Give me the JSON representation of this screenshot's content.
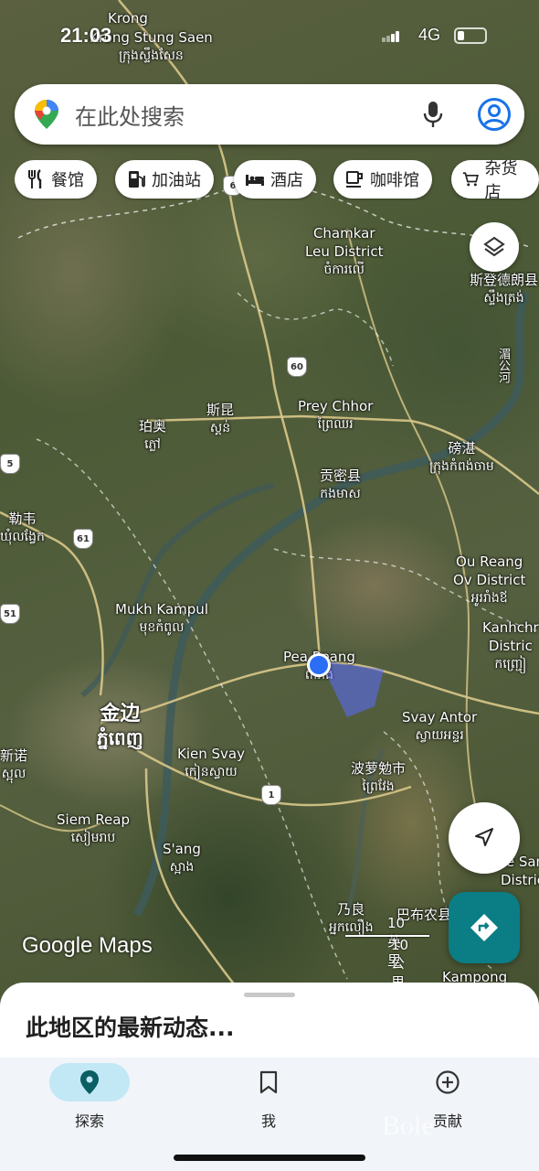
{
  "status_bar": {
    "time": "21:03",
    "network": "4G",
    "battery_level": 0.25
  },
  "search": {
    "placeholder": "在此处搜索"
  },
  "chips": [
    {
      "label": "餐馆",
      "icon": "restaurant-icon"
    },
    {
      "label": "加油站",
      "icon": "gas-station-icon"
    },
    {
      "label": "酒店",
      "icon": "hotel-icon"
    },
    {
      "label": "咖啡馆",
      "icon": "coffee-icon"
    },
    {
      "label": "杂货店",
      "icon": "grocery-cart-icon"
    }
  ],
  "map": {
    "places": [
      {
        "name": "Krong Stung Saen",
        "prefix": "Krong",
        "khmer": "ក្រុងស្ទឹងសែន"
      },
      {
        "name": "Chamkar Leu District",
        "line1": "Chamkar",
        "line2": "Leu District",
        "khmer": "ចំការលើ"
      },
      {
        "name": "斯登德朗县",
        "khmer": "ស្ទឹងត្រង់"
      },
      {
        "name": "Prey Chhor",
        "khmer": "ព្រៃឈរ"
      },
      {
        "name": "斯昆",
        "khmer": "ស្គន់"
      },
      {
        "name": "珀奥",
        "khmer": "ភ្លៅ"
      },
      {
        "name": "贡密县",
        "khmer": "កងមាស"
      },
      {
        "name": "磅湛",
        "khmer": "ក្រុងកំពង់ចាម"
      },
      {
        "name": "勒韦",
        "khmer": "ឃុំលង្វែក"
      },
      {
        "name": "Ou Reang Ov District",
        "line1": "Ou Reang",
        "line2": "Ov District",
        "khmer": "អូររាំងឪ"
      },
      {
        "name": "Mukh Kampul",
        "khmer": "មុខកំពូល"
      },
      {
        "name": "Pea Reang",
        "khmer": "ពារាំង"
      },
      {
        "name": "Kanhchriech District",
        "line1": "Kanhchr",
        "line2": "Distric",
        "khmer": "កញ្ជ្រៀ"
      },
      {
        "name": "Svay Antor",
        "khmer": "ស្វាយអន្ទរ"
      },
      {
        "name": "金边",
        "khmer": "ភ្នំពេញ"
      },
      {
        "name": "Kien Svay",
        "khmer": "កៀនស្វាយ"
      },
      {
        "name": "波萝勉市",
        "khmer": "ព្រៃវែង"
      },
      {
        "name": "Siem Reap",
        "khmer": "សៀមរាប"
      },
      {
        "name": "S'ang",
        "khmer": "ស្អាង"
      },
      {
        "name": "乃良",
        "khmer": "អ្នកលឿង"
      },
      {
        "name": "巴布农县",
        "line1": "巴布农县"
      },
      {
        "name": "Kampong",
        "line1": "Kampong"
      },
      {
        "name": "Pea Sang District",
        "line1": "e San",
        "line2": "District"
      },
      {
        "name": "新诺",
        "khmer": "ស្អុល"
      },
      {
        "name": "湄公河",
        "line1": "湄公河"
      },
      {
        "name": "Krong (top)",
        "line1": "Krong"
      }
    ],
    "routes": [
      "6",
      "60",
      "61",
      "51",
      "5",
      "1"
    ],
    "scale": {
      "imperial": "10 英里",
      "metric": "10 公里"
    },
    "attribution": "Google Maps"
  },
  "fab": {
    "layers": "layers-icon",
    "locate": "navigation-arrow-icon",
    "directions": "directions-icon",
    "accent": "#0b7d84"
  },
  "sheet": {
    "title": "此地区的最新动态..."
  },
  "bottom_nav": [
    {
      "label": "探索",
      "icon": "explore-pin-icon",
      "active": true
    },
    {
      "label": "我",
      "icon": "bookmark-icon",
      "active": false
    },
    {
      "label": "贡献",
      "icon": "add-circle-icon",
      "active": false
    }
  ],
  "watermark": "Bole"
}
